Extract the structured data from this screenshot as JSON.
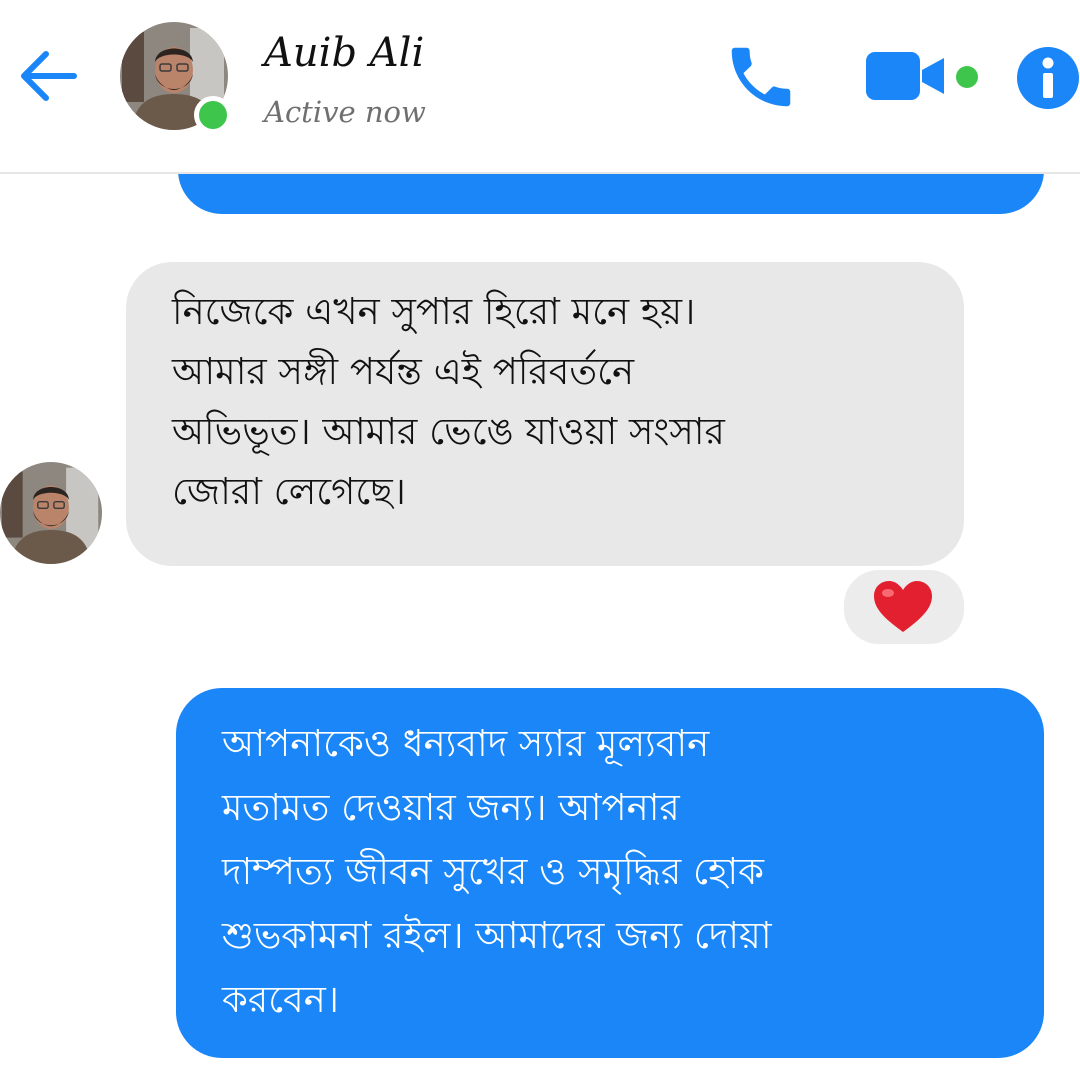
{
  "header": {
    "contact_name": "Auib Ali",
    "status": "Active now",
    "back_icon": "arrow-left-icon",
    "call_icon": "phone-icon",
    "video_icon": "video-camera-icon",
    "info_icon": "info-icon"
  },
  "messages": [
    {
      "direction": "incoming",
      "lines": [
        "নিজেকে এখন সুপার হিরো মনে হয়।",
        "আমার সঙ্গী পর্যন্ত এই পরিবর্তনে",
        "অভিভূত। আমার ভেঙে যাওয়া সংসার",
        "জোরা লেগেছে।"
      ],
      "reaction": "❤️"
    },
    {
      "direction": "outgoing",
      "lines": [
        "আপনাকেও ধন্যবাদ স্যার মূল্যবান",
        "মতামত দেওয়ার জন্য। আপনার",
        "দাম্পত্য জীবন সুখের ও সমৃদ্ধির হোক",
        "শুভকামনা রইল। আমাদের জন্য দোয়া",
        "করবেন।"
      ]
    }
  ],
  "colors": {
    "accent": "#1a86f7",
    "presence": "#3ec54b",
    "incoming_bubble": "#e8e8e8",
    "reaction_heart": "#e3202f"
  }
}
